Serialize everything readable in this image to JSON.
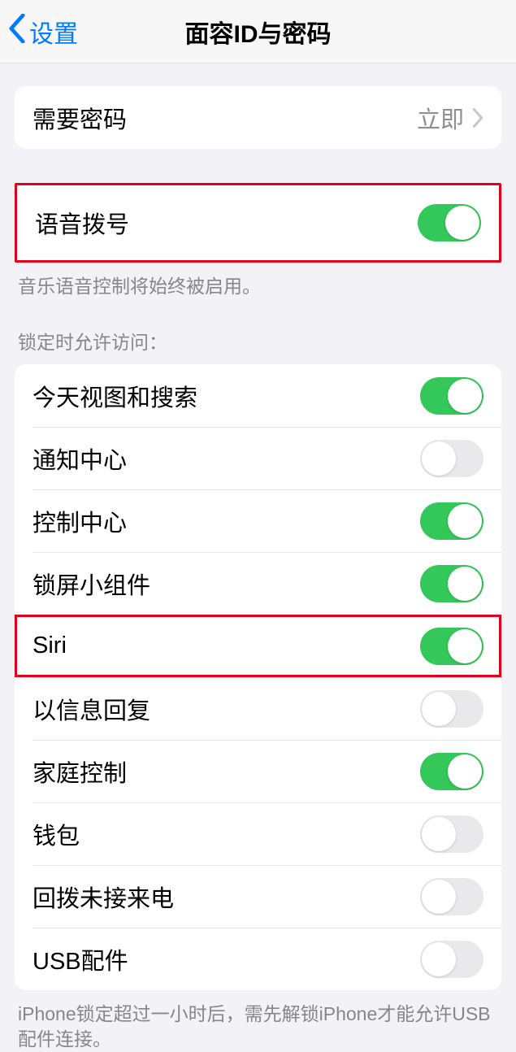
{
  "nav": {
    "back_label": "设置",
    "title": "面容ID与密码"
  },
  "passcode": {
    "label": "需要密码",
    "value": "立即"
  },
  "voice_dial": {
    "label": "语音拨号",
    "footer": "音乐语音控制将始终被启用。"
  },
  "lock_access": {
    "header": "锁定时允许访问：",
    "items": [
      {
        "label": "今天视图和搜索",
        "on": true
      },
      {
        "label": "通知中心",
        "on": false
      },
      {
        "label": "控制中心",
        "on": true
      },
      {
        "label": "锁屏小组件",
        "on": true
      },
      {
        "label": "Siri",
        "on": true,
        "highlight": true
      },
      {
        "label": "以信息回复",
        "on": false
      },
      {
        "label": "家庭控制",
        "on": true
      },
      {
        "label": "钱包",
        "on": false
      },
      {
        "label": "回拨未接来电",
        "on": false
      },
      {
        "label": "USB配件",
        "on": false
      }
    ],
    "footer": "iPhone锁定超过一小时后，需先解锁iPhone才能允许USB配件连接。"
  }
}
